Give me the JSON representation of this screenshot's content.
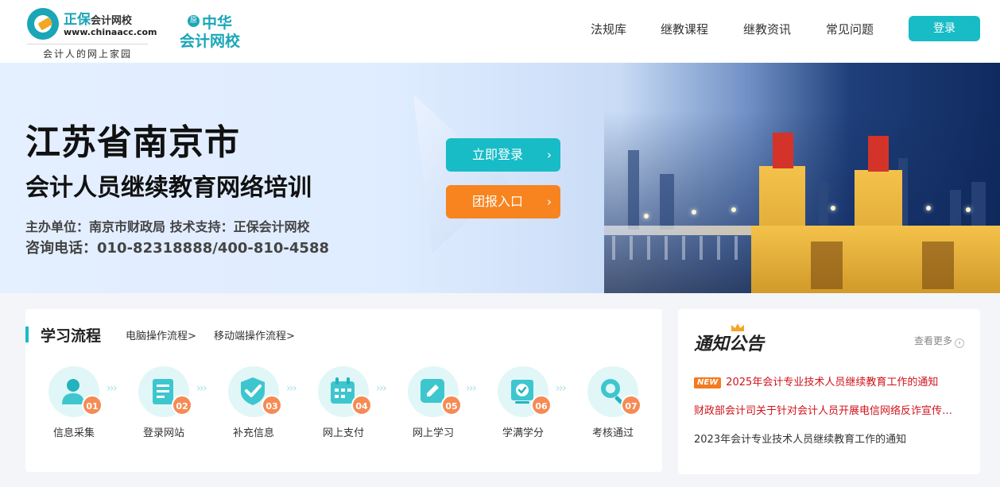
{
  "header": {
    "logo_primary": {
      "name": "正保",
      "name_small": "会计网校",
      "url": "www.chinaacc.com",
      "slogan": "会计人的网上家园"
    },
    "logo_secondary": {
      "badge": "原",
      "line1": "中华",
      "line2": "会计网校"
    },
    "nav": [
      "法规库",
      "继教课程",
      "继教资讯",
      "常见问题"
    ],
    "login_label": "登录"
  },
  "banner": {
    "title_line1": "江苏省南京市",
    "title_line2": "会计人员继续教育网络培训",
    "organizer": "主办单位：南京市财政局  技术支持：正保会计网校",
    "hotline": "咨询电话：010-82318888/400-810-4588",
    "login_now": "立即登录",
    "group_entry": "团报入口",
    "arrow": "›"
  },
  "process": {
    "title": "学习流程",
    "links": [
      "电脑操作流程>",
      "移动端操作流程>"
    ],
    "steps": [
      {
        "num": "01",
        "label": "信息采集",
        "icon": "user-icon"
      },
      {
        "num": "02",
        "label": "登录网站",
        "icon": "document-icon"
      },
      {
        "num": "03",
        "label": "补充信息",
        "icon": "shield-check-icon"
      },
      {
        "num": "04",
        "label": "网上支付",
        "icon": "calendar-icon"
      },
      {
        "num": "05",
        "label": "网上学习",
        "icon": "edit-icon"
      },
      {
        "num": "06",
        "label": "学满学分",
        "icon": "certificate-icon"
      },
      {
        "num": "07",
        "label": "考核通过",
        "icon": "search-icon"
      }
    ],
    "arrow_glyph": "› › ›"
  },
  "notice": {
    "title": "通知公告",
    "more": "查看更多",
    "more_icon": "›",
    "new_badge": "NEW",
    "items": [
      {
        "text": "2025年会计专业技术人员继续教育工作的通知",
        "color": "#d0121b"
      },
      {
        "text": "财政部会计司关于针对会计人员开展电信网络反诈宣传的通知",
        "color": "#d0121b"
      },
      {
        "text": "2023年会计专业技术人员继续教育工作的通知",
        "color": "#333333"
      }
    ]
  },
  "colors": {
    "accent": "#17bcc6",
    "orange": "#f7841f",
    "step_num": "#f58b54",
    "notice_red": "#d0121b"
  }
}
